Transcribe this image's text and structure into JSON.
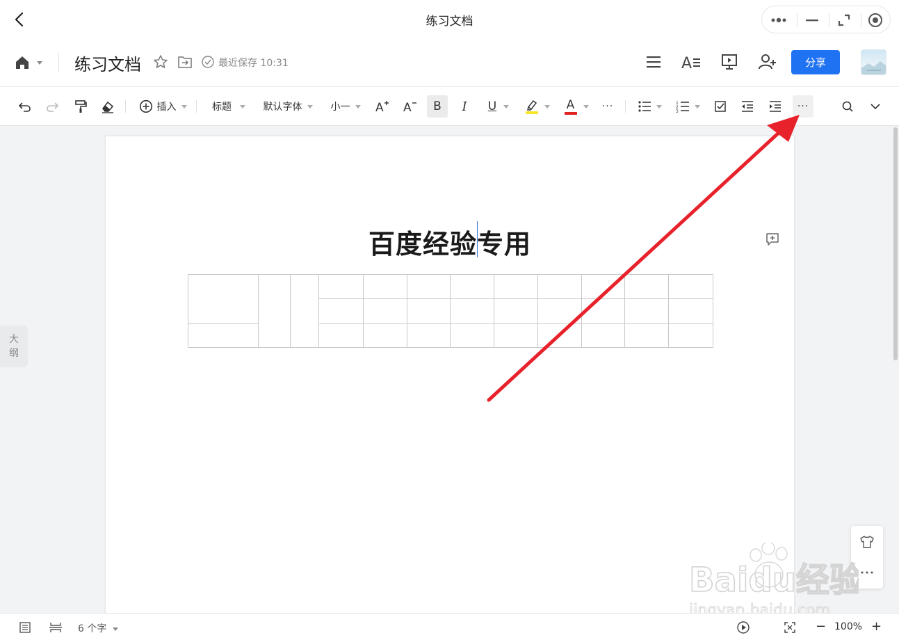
{
  "window": {
    "title": "练习文档"
  },
  "header": {
    "doc_title": "练习文档",
    "save_status": "最近保存 10:31",
    "share_label": "分享"
  },
  "toolbar": {
    "insert_label": "插入",
    "heading_label": "标题",
    "font_label": "默认字体",
    "size_label": "小一",
    "bold_label": "B",
    "italic_label": "I",
    "underline_label": "U",
    "font_color_label": "A",
    "more_label": "···",
    "highlight_color": "#f5e62a",
    "font_color": "#e02424"
  },
  "document": {
    "heading": "百度经验专用"
  },
  "sidebar": {
    "outline_label": "大纲"
  },
  "statusbar": {
    "word_count": "6 个字",
    "zoom": "100%",
    "zoom_out": "−",
    "zoom_in": "+"
  },
  "annotation": {
    "arrow_color": "#e8222b"
  },
  "watermark": {
    "brand": "Baidu经验",
    "url": "jingyan.baidu.com"
  }
}
